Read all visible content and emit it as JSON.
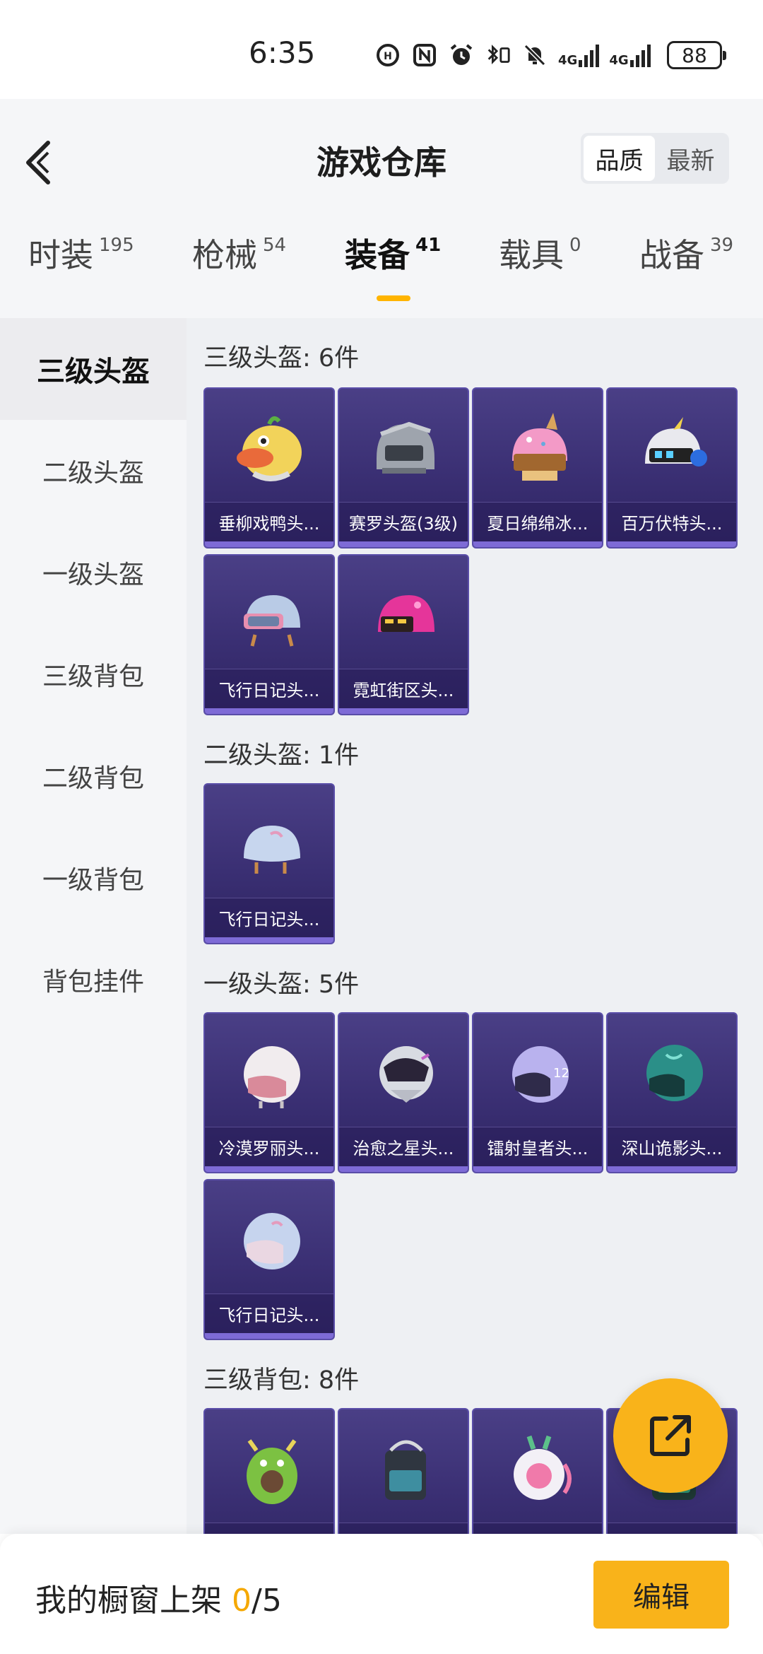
{
  "status_bar": {
    "time": "6:35",
    "battery": "88",
    "network_1": "4G",
    "network_2": "4G"
  },
  "header": {
    "title": "游戏仓库",
    "sort_options": [
      "品质",
      "最新"
    ],
    "sort_active": "品质"
  },
  "tabs": [
    {
      "label": "时装",
      "count": "195"
    },
    {
      "label": "枪械",
      "count": "54"
    },
    {
      "label": "装备",
      "count": "41",
      "active": true
    },
    {
      "label": "载具",
      "count": "0"
    },
    {
      "label": "战备",
      "count": "39"
    }
  ],
  "sidebar": {
    "items": [
      "三级头盔",
      "二级头盔",
      "一级头盔",
      "三级背包",
      "二级背包",
      "一级背包",
      "背包挂件"
    ],
    "active": "三级头盔"
  },
  "sections": [
    {
      "title": "三级头盔: 6件",
      "items": [
        {
          "name": "垂柳戏鸭头...",
          "icon": "duck-helmet-icon"
        },
        {
          "name": "赛罗头盔(3级)",
          "icon": "level3-helmet-icon"
        },
        {
          "name": "夏日绵绵冰...",
          "icon": "icecream-helmet-icon"
        },
        {
          "name": "百万伏特头...",
          "icon": "volt-helmet-icon"
        },
        {
          "name": "飞行日记头...",
          "icon": "flight-helmet-icon"
        },
        {
          "name": "霓虹街区头...",
          "icon": "neon-helmet-icon"
        }
      ]
    },
    {
      "title": "二级头盔: 1件",
      "items": [
        {
          "name": "飞行日记头...",
          "icon": "flight-helmet-icon"
        }
      ]
    },
    {
      "title": "一级头盔: 5件",
      "items": [
        {
          "name": "冷漠罗丽头...",
          "icon": "white-helmet-icon"
        },
        {
          "name": "治愈之星头...",
          "icon": "star-helmet-icon"
        },
        {
          "name": "镭射皇者头...",
          "icon": "laser-helmet-icon"
        },
        {
          "name": "深山诡影头...",
          "icon": "teal-helmet-icon"
        },
        {
          "name": "飞行日记头...",
          "icon": "flight-helmet-icon"
        }
      ]
    },
    {
      "title": "三级背包: 8件",
      "items": [
        {
          "name": "",
          "icon": "dragon-backpack-icon"
        },
        {
          "name": "",
          "icon": "tech-backpack-icon"
        },
        {
          "name": "",
          "icon": "bunny-backpack-icon"
        },
        {
          "name": "",
          "icon": "green-backpack-icon"
        }
      ]
    }
  ],
  "bottom_bar": {
    "label": "我的橱窗上架 ",
    "current": "0",
    "total": "/5",
    "edit_label": "编辑"
  },
  "colors": {
    "accent": "#f9b31a",
    "card_bg": "#3a2f73",
    "card_edge": "#7e6bd6"
  }
}
